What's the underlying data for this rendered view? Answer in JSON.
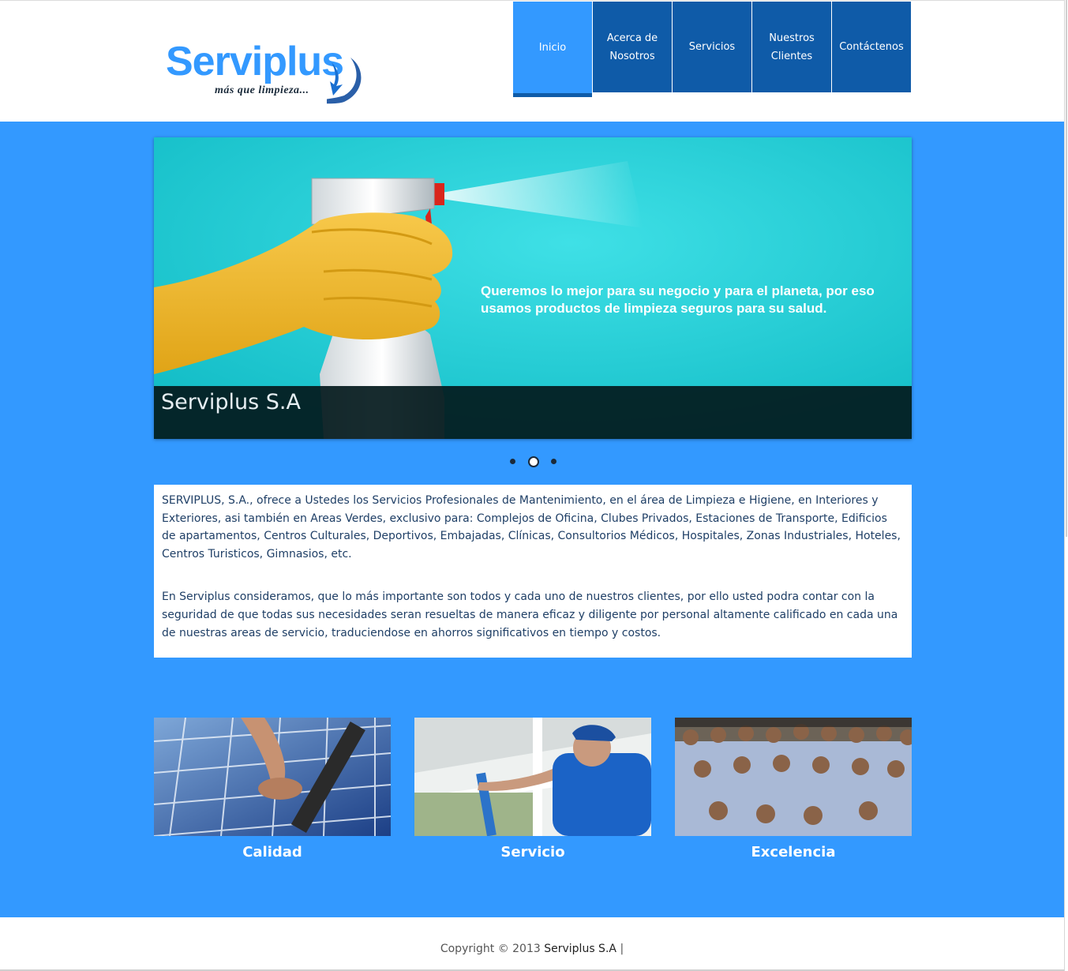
{
  "brand": {
    "name": "Serviplus",
    "tagline": "más que limpieza..."
  },
  "nav": {
    "items": [
      {
        "label": "Inicio",
        "active": true
      },
      {
        "label": "Acerca de Nosotros",
        "active": false
      },
      {
        "label": "Servicios",
        "active": false
      },
      {
        "label": "Nuestros Clientes",
        "active": false
      },
      {
        "label": "Contáctenos",
        "active": false
      }
    ]
  },
  "slider": {
    "slide_text": "Queremos lo mejor para su negocio y para el planeta, por eso usamos productos de limpieza seguros para su salud.",
    "caption": "Serviplus S.A",
    "dots_total": 3,
    "active_dot": 2
  },
  "intro": {
    "paragraph1": "SERVIPLUS, S.A., ofrece a Ustedes los Servicios Profesionales de Mantenimiento, en el área de Limpieza e Higiene, en Interiores y Exteriores, asi también en Areas Verdes, exclusivo para: Complejos de Oficina, Clubes Privados, Estaciones de Transporte, Edificios de apartamentos, Centros Culturales, Deportivos, Embajadas, Clínicas, Consultorios Médicos, Hospitales, Zonas Industriales, Hoteles, Centros Turisticos, Gimnasios, etc.",
    "paragraph2": "En Serviplus consideramos, que lo más importante son todos y cada uno de nuestros clientes, por ello usted podra contar con la seguridad de que todas sus necesidades seran resueltas de manera eficaz y diligente por personal altamente calificado en cada una de nuestras areas de servicio, traduciendose en ahorros significativos en tiempo y costos."
  },
  "features": [
    {
      "title": "Calidad"
    },
    {
      "title": "Servicio"
    },
    {
      "title": "Excelencia"
    }
  ],
  "footer": {
    "copyright_prefix": "Copyright © 2013",
    "company": "Serviplus S.A",
    "separator": "|"
  },
  "colors": {
    "primary_blue": "#3399ff",
    "nav_dark_blue": "#0f5ba8",
    "slide_teal": "#1fc7cf",
    "text_blue": "#1f3f66"
  }
}
